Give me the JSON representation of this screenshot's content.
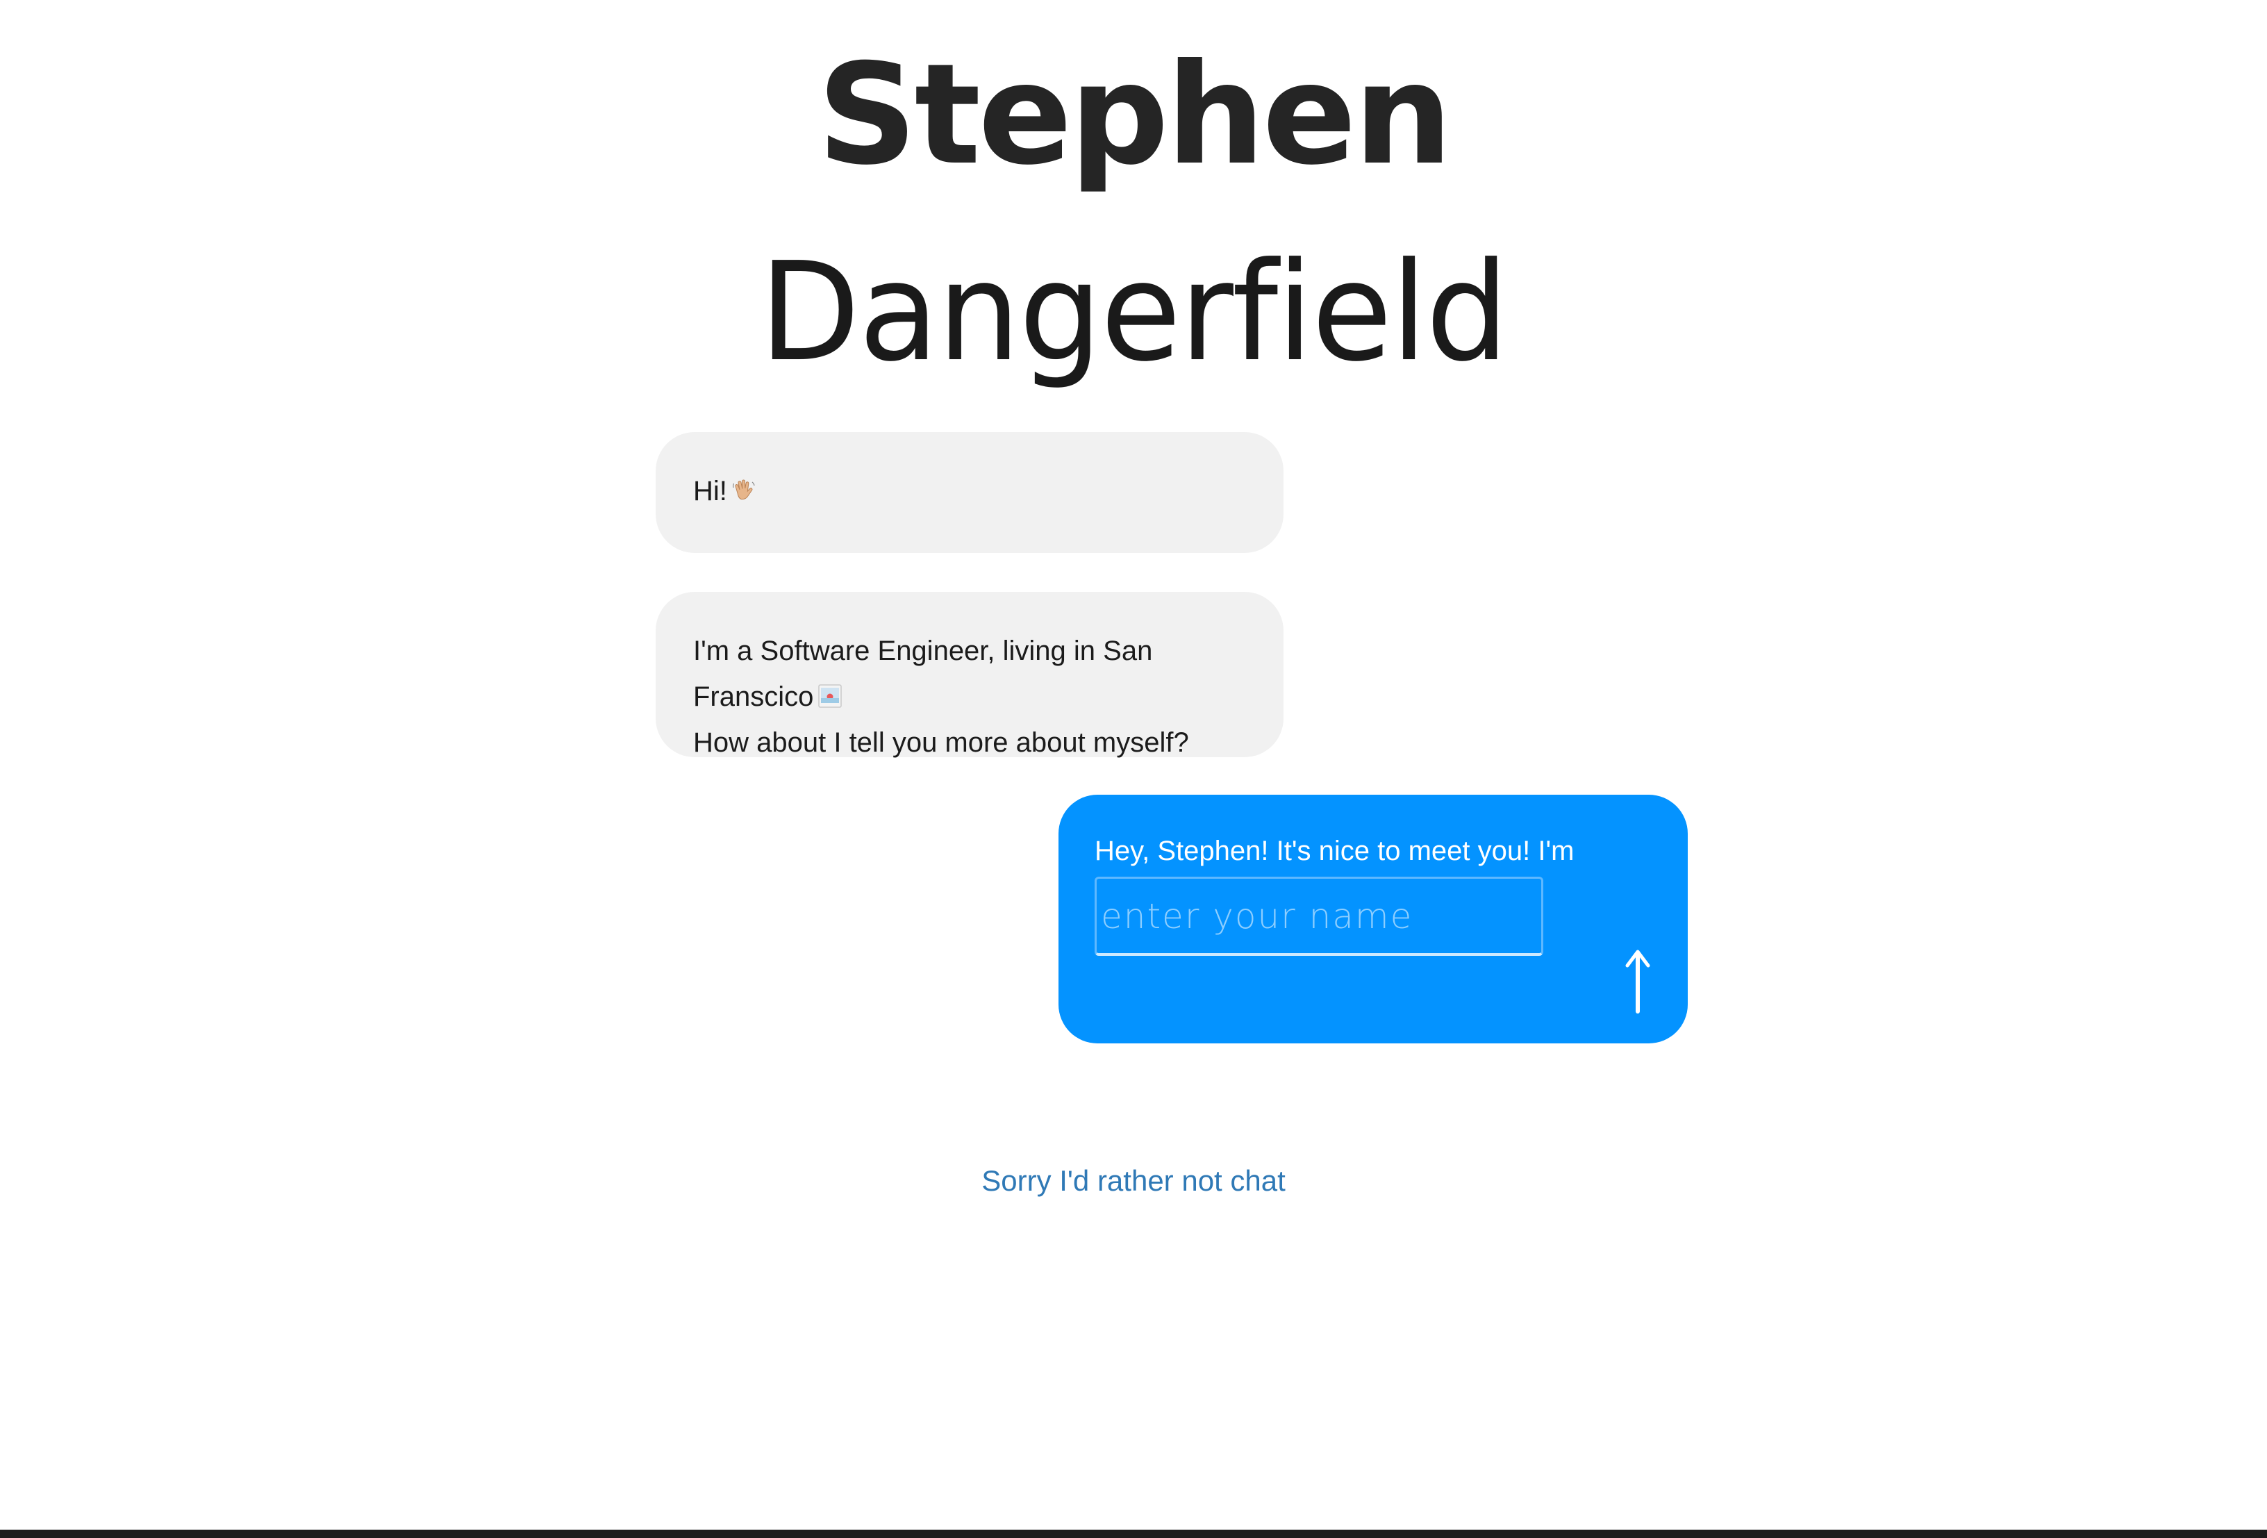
{
  "header": {
    "first_name": "Stephen",
    "last_name": "Dangerfield"
  },
  "chat": {
    "messages": [
      {
        "line1": "Hi!",
        "emoji": "waving-hand-icon"
      },
      {
        "line1": "I'm a Software Engineer, living in San Franscico",
        "emoji": "sunset-photo-icon",
        "line2": "How about I tell you more about myself?"
      }
    ],
    "reply": {
      "text": "Hey, Stephen! It's nice to meet you! I'm",
      "placeholder": "enter your name",
      "send_icon": "arrow-up-icon"
    }
  },
  "decline_link": "Sorry I'd rather not chat",
  "colors": {
    "incoming_bubble": "#f1f1f1",
    "outgoing_bubble": "#0493ff",
    "link": "#2f79b6",
    "title": "#252525"
  }
}
